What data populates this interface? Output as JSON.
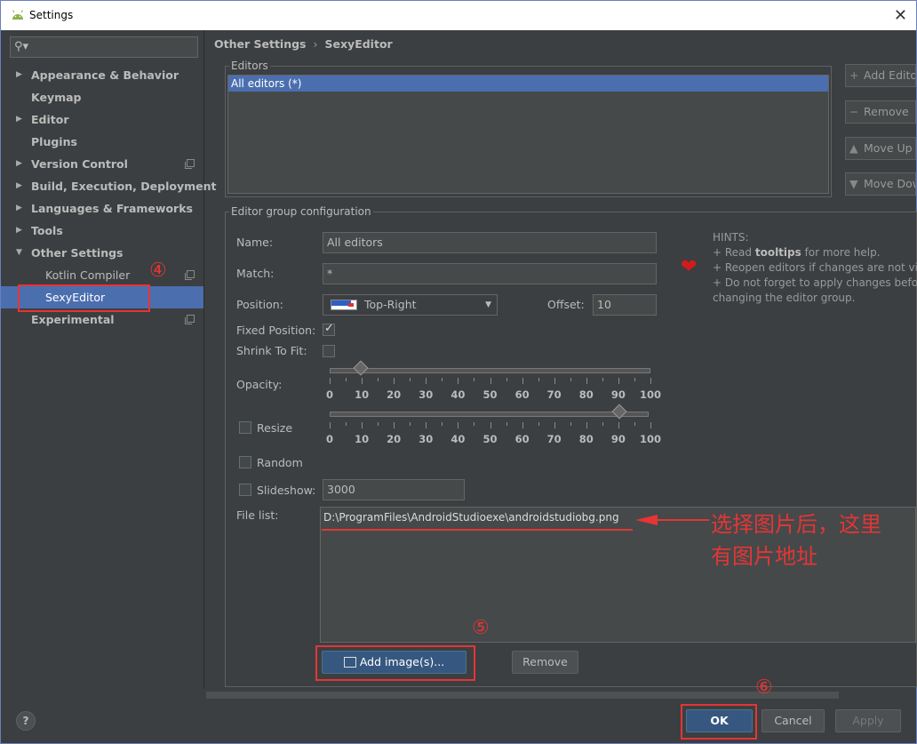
{
  "window": {
    "title": "Settings"
  },
  "search": {
    "placeholder": ""
  },
  "sidebar": {
    "items": [
      {
        "label": "Appearance & Behavior",
        "arrow": "▶"
      },
      {
        "label": "Keymap"
      },
      {
        "label": "Editor",
        "arrow": "▶"
      },
      {
        "label": "Plugins"
      },
      {
        "label": "Version Control",
        "arrow": "▶"
      },
      {
        "label": "Build, Execution, Deployment",
        "arrow": "▶"
      },
      {
        "label": "Languages & Frameworks",
        "arrow": "▶"
      },
      {
        "label": "Tools",
        "arrow": "▶"
      },
      {
        "label": "Other Settings",
        "arrow": "▼"
      },
      {
        "label": "Kotlin Compiler"
      },
      {
        "label": "SexyEditor"
      },
      {
        "label": "Experimental"
      }
    ],
    "selected": "SexyEditor"
  },
  "breadcrumb": {
    "parent": "Other Settings",
    "current": "SexyEditor",
    "separator": "›"
  },
  "editors": {
    "legend": "Editors",
    "items": [
      "All editors (*)"
    ],
    "buttons": {
      "add": "Add Editor",
      "remove": "Remove",
      "move_up": "Move Up",
      "move_down": "Move Down"
    }
  },
  "config": {
    "legend": "Editor group configuration",
    "name_label": "Name:",
    "name_value": "All editors",
    "match_label": "Match:",
    "match_value": "*",
    "position_label": "Position:",
    "position_value": "Top-Right",
    "offset_label": "Offset:",
    "offset_value": "10",
    "fixed_position_label": "Fixed Position:",
    "fixed_position_checked": true,
    "shrink_label": "Shrink To Fit:",
    "shrink_checked": false,
    "opacity_label": "Opacity:",
    "opacity_value": 10,
    "resize_label": "Resize",
    "resize_checked": false,
    "resize_value": 90,
    "random_label": "Random",
    "random_checked": false,
    "slideshow_label": "Slideshow:",
    "slideshow_checked": false,
    "slideshow_value": "3000",
    "slider_ticks": [
      "0",
      "10",
      "20",
      "30",
      "40",
      "50",
      "60",
      "70",
      "80",
      "90",
      "100"
    ],
    "file_list_label": "File list:",
    "file_list": [
      "D:\\ProgramFiles\\AndroidStudioexe\\androidstudiobg.png"
    ],
    "add_image_label": "Add image(s)...",
    "remove_label": "Remove"
  },
  "hints": {
    "title": "HINTS:",
    "line1_pre": "+ Read ",
    "line1_bold": "tooltips",
    "line1_post": " for more help.",
    "line2": "+ Reopen editors if changes are not vi",
    "line3": "+ Do not forget to apply changes befo",
    "line4": "changing the editor group."
  },
  "annotations": {
    "step4": "④",
    "step5": "⑤",
    "step6": "⑥",
    "note_line1": "选择图片后，这里",
    "note_line2": "有图片地址",
    "color": "#e53535"
  },
  "footer": {
    "help": "?",
    "ok": "OK",
    "cancel": "Cancel",
    "apply": "Apply"
  },
  "colors": {
    "background": "#3c3f41",
    "selection": "#4b6eaf",
    "primary_button": "#365880",
    "heart": "#d41b1b"
  }
}
